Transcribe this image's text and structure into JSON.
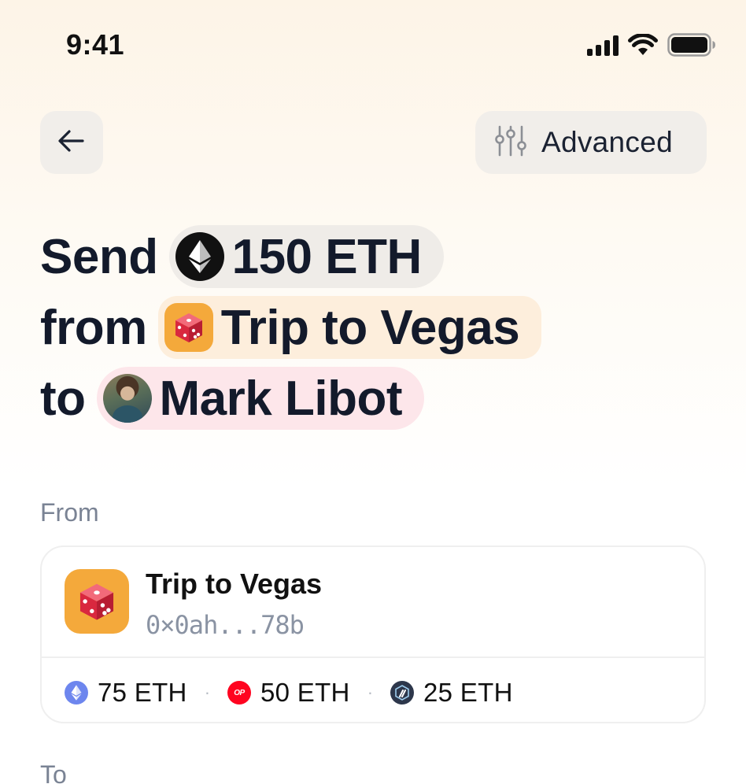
{
  "status_bar": {
    "time": "9:41"
  },
  "header": {
    "advanced_label": "Advanced"
  },
  "headline": {
    "send_word": "Send",
    "amount": "150 ETH",
    "from_word": "from",
    "wallet": "Trip to Vegas",
    "to_word": "to",
    "recipient": "Mark Libot"
  },
  "from_section": {
    "label": "From",
    "wallet_name": "Trip to Vegas",
    "wallet_address": "0×0ah...78b",
    "balances": [
      {
        "chain_icon": "ethereum-icon",
        "amount": "75 ETH"
      },
      {
        "chain_icon": "optimism-icon",
        "amount": "50 ETH"
      },
      {
        "chain_icon": "arbitrum-icon",
        "amount": "25 ETH"
      }
    ],
    "separator": "·"
  },
  "to_section": {
    "label": "To"
  },
  "colors": {
    "token_pill": "#efece8",
    "wallet_pill": "#fdeedc",
    "recipient_pill": "#fde6ea",
    "dice_orange": "#f4a93b",
    "dice_red": "#e0334a",
    "muted_text": "#7a8394"
  }
}
